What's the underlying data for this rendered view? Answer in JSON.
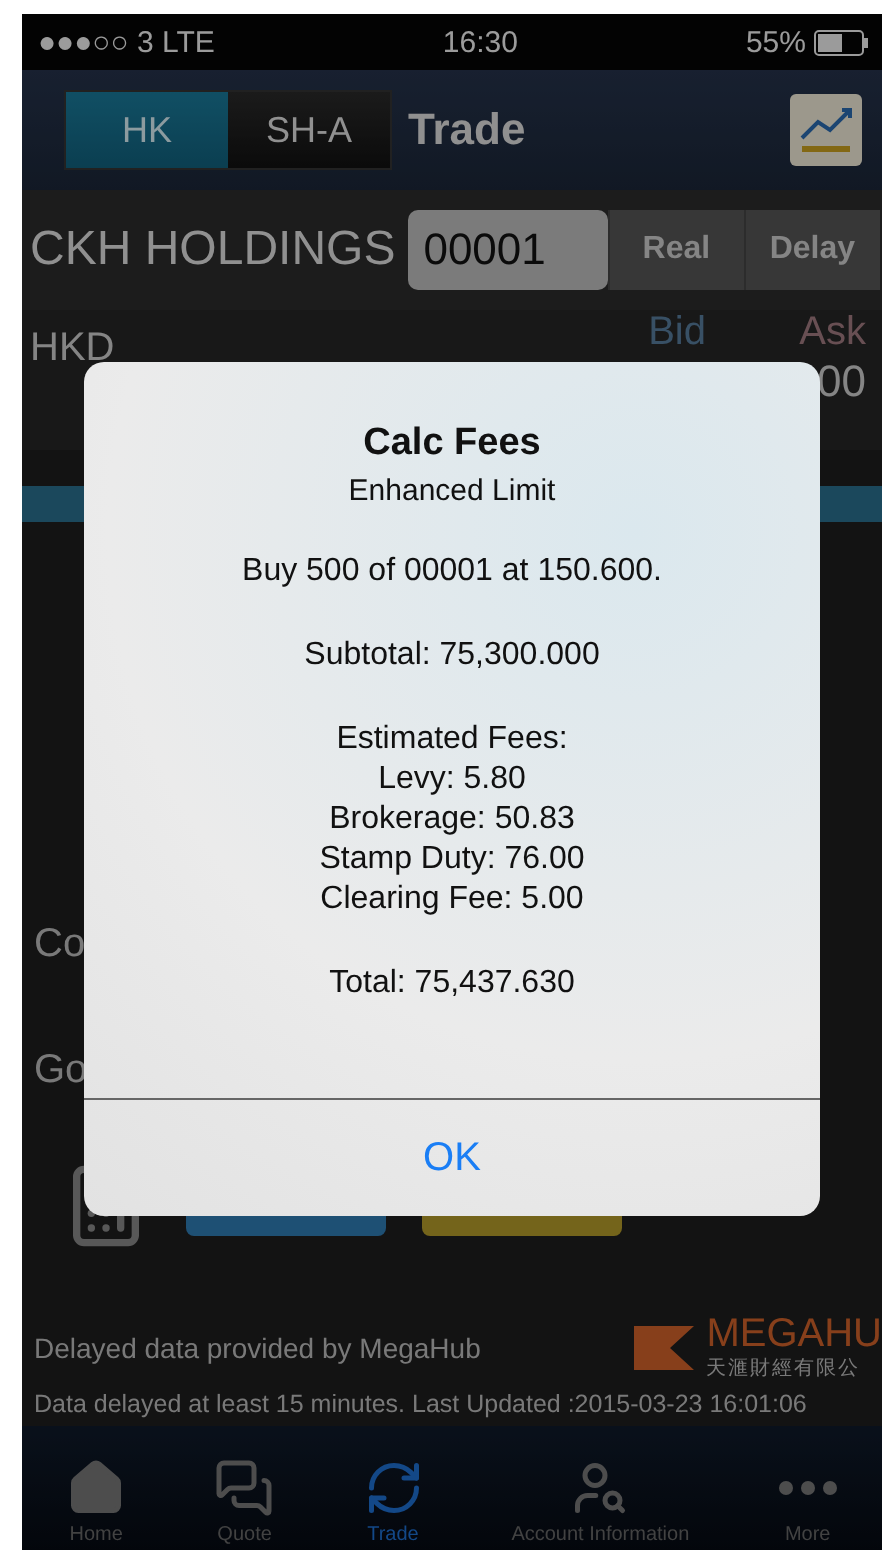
{
  "status_bar": {
    "carrier": "●●●○○ 3  LTE",
    "time": "16:30",
    "battery": "55%"
  },
  "header": {
    "tabs": [
      {
        "label": "HK",
        "selected": true
      },
      {
        "label": "SH-A",
        "selected": false
      }
    ],
    "title": "Trade"
  },
  "stock": {
    "name": "CKH HOLDINGS",
    "code": "00001",
    "modes": [
      "Real",
      "Delay"
    ]
  },
  "quote": {
    "currency": "HKD",
    "bid_label": "Bid",
    "ask_label": "Ask",
    "ask_value": "00"
  },
  "form_labels": [
    "Co",
    "Go"
  ],
  "dialog": {
    "title": "Calc Fees",
    "subtitle": "Enhanced Limit",
    "paragraphs": [
      [
        "Buy 500 of 00001 at 150.600."
      ],
      [
        "Subtotal: 75,300.000"
      ],
      [
        "Estimated Fees:",
        "Levy: 5.80",
        "Brokerage: 50.83",
        "Stamp Duty: 76.00",
        "Clearing Fee: 5.00"
      ],
      [
        "Total: 75,437.630"
      ]
    ],
    "button": "OK"
  },
  "footer": {
    "provider": "Delayed  data provided by MegaHub",
    "logo": "MEGAHU",
    "logo_sub": "天滙財經有限公",
    "notice": "Data delayed at least 15 minutes.  Last Updated :2015-03-23 16:01:06"
  },
  "tabbar": [
    {
      "label": "Home",
      "kind": "home",
      "selected": false
    },
    {
      "label": "Quote",
      "kind": "quote",
      "selected": false
    },
    {
      "label": "Trade",
      "kind": "trade",
      "selected": true
    },
    {
      "label": "Account Information",
      "kind": "account",
      "selected": false
    },
    {
      "label": "More",
      "kind": "more",
      "selected": false
    }
  ]
}
